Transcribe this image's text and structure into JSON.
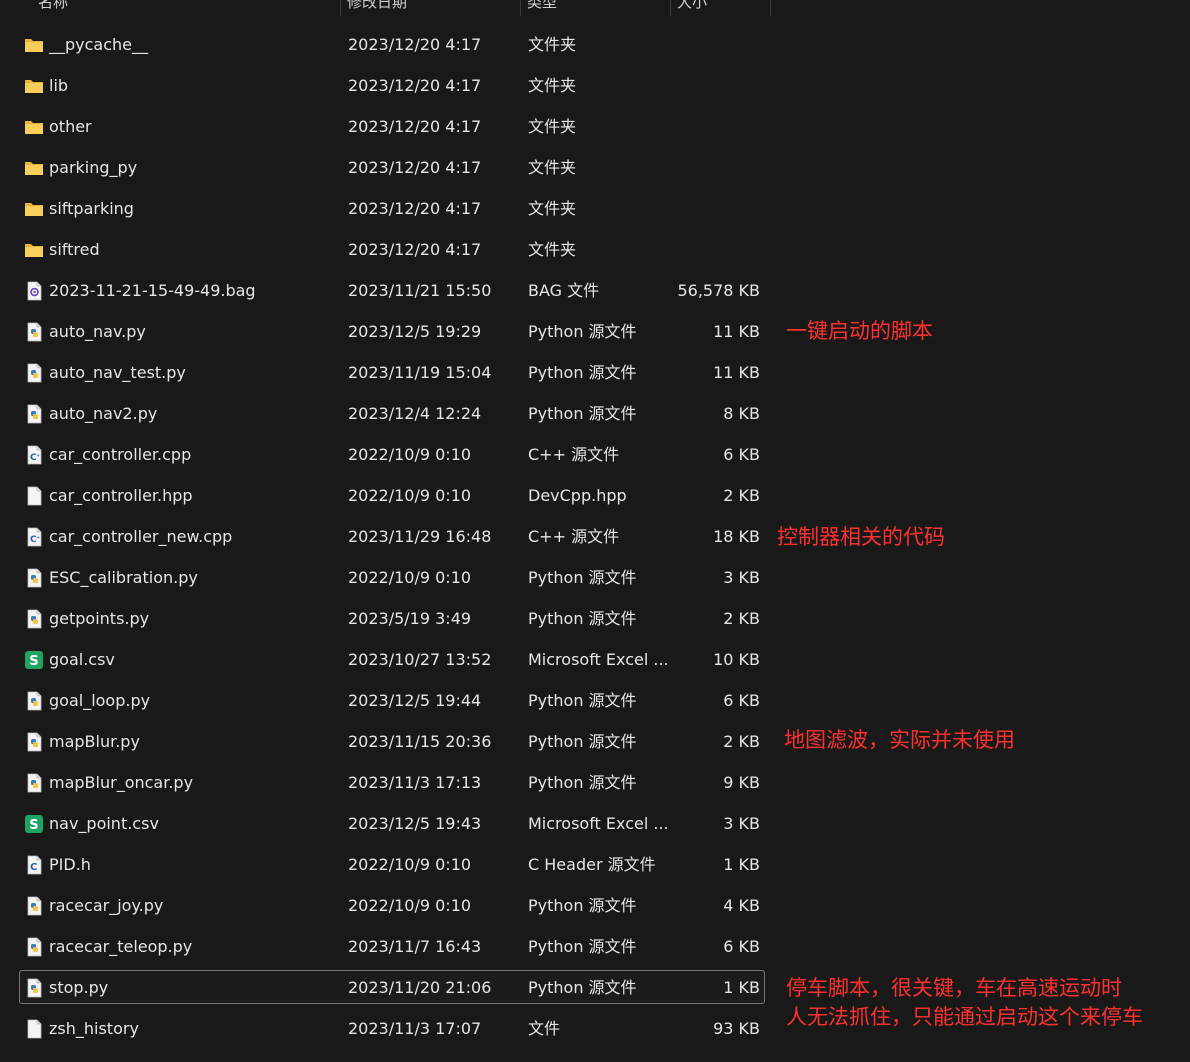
{
  "columns": {
    "name": "名称",
    "modified": "修改日期",
    "type": "类型",
    "size": "大小"
  },
  "files": [
    {
      "name": "__pycache__",
      "modified": "2023/12/20 4:17",
      "type": "文件夹",
      "size": "",
      "icon": "folder-icon"
    },
    {
      "name": "lib",
      "modified": "2023/12/20 4:17",
      "type": "文件夹",
      "size": "",
      "icon": "folder-icon"
    },
    {
      "name": "other",
      "modified": "2023/12/20 4:17",
      "type": "文件夹",
      "size": "",
      "icon": "folder-icon"
    },
    {
      "name": "parking_py",
      "modified": "2023/12/20 4:17",
      "type": "文件夹",
      "size": "",
      "icon": "folder-icon"
    },
    {
      "name": "siftparking",
      "modified": "2023/12/20 4:17",
      "type": "文件夹",
      "size": "",
      "icon": "folder-icon"
    },
    {
      "name": "siftred",
      "modified": "2023/12/20 4:17",
      "type": "文件夹",
      "size": "",
      "icon": "folder-icon"
    },
    {
      "name": "2023-11-21-15-49-49.bag",
      "modified": "2023/11/21 15:50",
      "type": "BAG 文件",
      "size": "56,578 KB",
      "icon": "bag-file-icon"
    },
    {
      "name": "auto_nav.py",
      "modified": "2023/12/5 19:29",
      "type": "Python 源文件",
      "size": "11 KB",
      "icon": "python-file-icon"
    },
    {
      "name": "auto_nav_test.py",
      "modified": "2023/11/19 15:04",
      "type": "Python 源文件",
      "size": "11 KB",
      "icon": "python-file-icon"
    },
    {
      "name": "auto_nav2.py",
      "modified": "2023/12/4 12:24",
      "type": "Python 源文件",
      "size": "8 KB",
      "icon": "python-file-icon"
    },
    {
      "name": "car_controller.cpp",
      "modified": "2022/10/9 0:10",
      "type": "C++ 源文件",
      "size": "6 KB",
      "icon": "cpp-file-icon"
    },
    {
      "name": "car_controller.hpp",
      "modified": "2022/10/9 0:10",
      "type": "DevCpp.hpp",
      "size": "2 KB",
      "icon": "blank-file-icon"
    },
    {
      "name": "car_controller_new.cpp",
      "modified": "2023/11/29 16:48",
      "type": "C++ 源文件",
      "size": "18 KB",
      "icon": "cpp-file-icon"
    },
    {
      "name": "ESC_calibration.py",
      "modified": "2022/10/9 0:10",
      "type": "Python 源文件",
      "size": "3 KB",
      "icon": "python-file-icon"
    },
    {
      "name": "getpoints.py",
      "modified": "2023/5/19 3:49",
      "type": "Python 源文件",
      "size": "2 KB",
      "icon": "python-file-icon"
    },
    {
      "name": "goal.csv",
      "modified": "2023/10/27 13:52",
      "type": "Microsoft Excel ...",
      "size": "10 KB",
      "icon": "spreadsheet-file-icon"
    },
    {
      "name": "goal_loop.py",
      "modified": "2023/12/5 19:44",
      "type": "Python 源文件",
      "size": "6 KB",
      "icon": "python-file-icon"
    },
    {
      "name": "mapBlur.py",
      "modified": "2023/11/15 20:36",
      "type": "Python 源文件",
      "size": "2 KB",
      "icon": "python-file-icon"
    },
    {
      "name": "mapBlur_oncar.py",
      "modified": "2023/11/3 17:13",
      "type": "Python 源文件",
      "size": "9 KB",
      "icon": "python-file-icon"
    },
    {
      "name": "nav_point.csv",
      "modified": "2023/12/5 19:43",
      "type": "Microsoft Excel ...",
      "size": "3 KB",
      "icon": "spreadsheet-file-icon"
    },
    {
      "name": "PID.h",
      "modified": "2022/10/9 0:10",
      "type": "C Header 源文件",
      "size": "1 KB",
      "icon": "c-header-file-icon"
    },
    {
      "name": "racecar_joy.py",
      "modified": "2022/10/9 0:10",
      "type": "Python 源文件",
      "size": "4 KB",
      "icon": "python-file-icon"
    },
    {
      "name": "racecar_teleop.py",
      "modified": "2023/11/7 16:43",
      "type": "Python 源文件",
      "size": "6 KB",
      "icon": "python-file-icon"
    },
    {
      "name": "stop.py",
      "modified": "2023/11/20 21:06",
      "type": "Python 源文件",
      "size": "1 KB",
      "icon": "python-file-icon",
      "selected": true
    },
    {
      "name": "zsh_history",
      "modified": "2023/11/3 17:07",
      "type": "文件",
      "size": "93 KB",
      "icon": "blank-file-icon"
    }
  ],
  "annotations": {
    "auto_nav": "一键启动的脚本",
    "controller": "控制器相关的代码",
    "mapblur": "地图滤波，实际并未使用",
    "stop_line1": "停车脚本，很关键，车在高速运动时",
    "stop_line2": "人无法抓住，只能通过启动这个来停车"
  },
  "colors": {
    "background": "#191919",
    "text": "#e6e6e6",
    "annotation": "#ff3030",
    "folder": "#f2c14e",
    "python_blue": "#3b7bbf",
    "spreadsheet_green": "#1fa463"
  }
}
